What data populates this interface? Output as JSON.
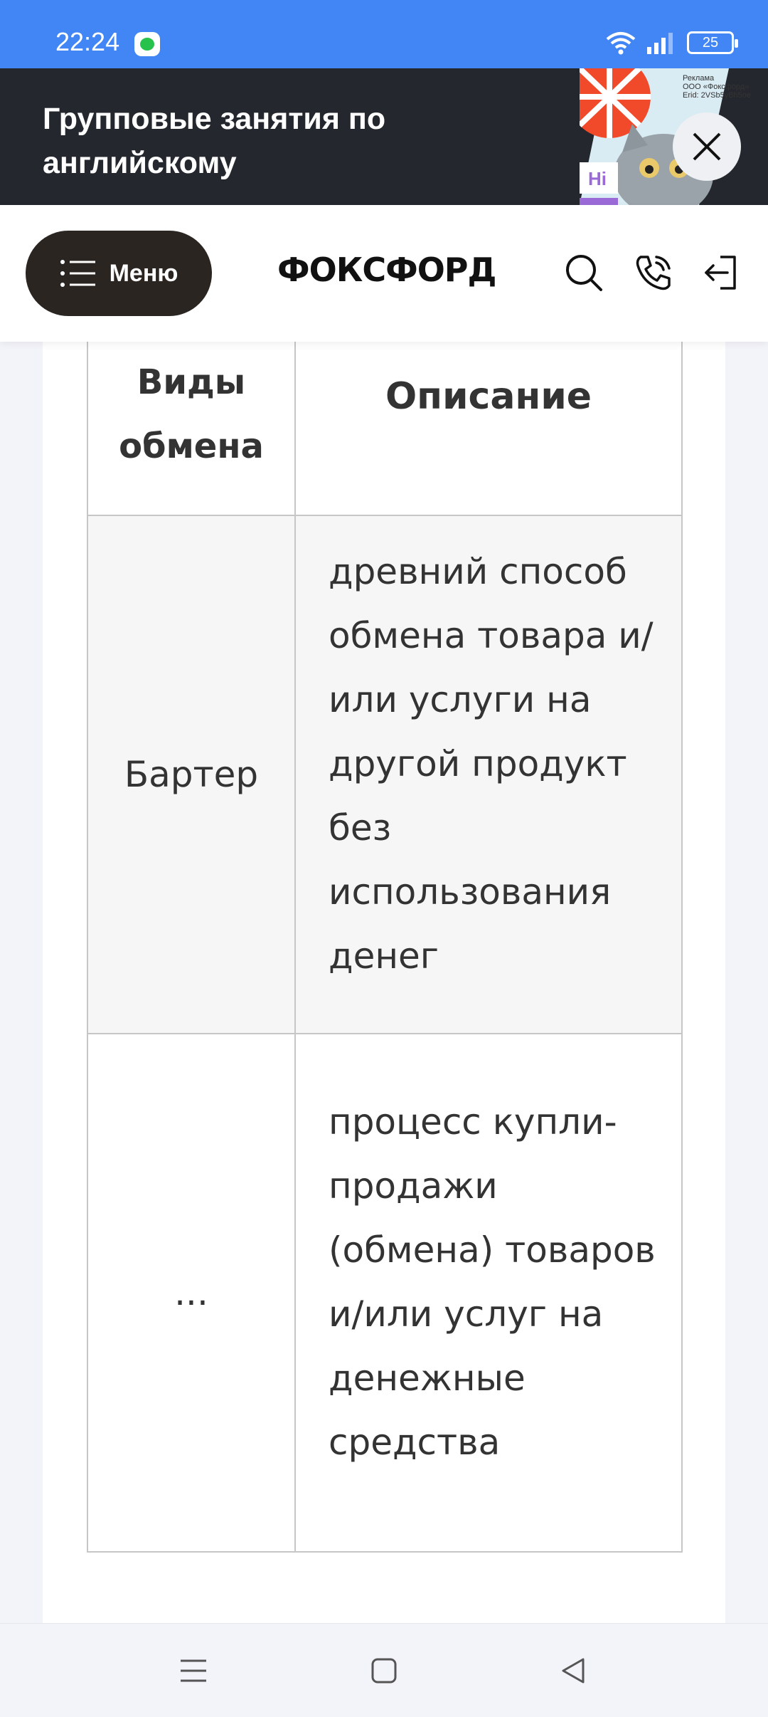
{
  "status_bar": {
    "time": "22:24",
    "battery": "25",
    "icons": [
      "message-app-icon",
      "wifi-icon",
      "signal-icon",
      "battery-icon"
    ]
  },
  "ad": {
    "title": "Групповые занятия по английскому",
    "meta_line1": "Реклама",
    "meta_line2": "ООО «Фоксфорд»",
    "meta_line3": "Erid: 2VSb5yBh5oe",
    "hi_badge": "Hi",
    "colors": {
      "background": "#24272e",
      "accent": "#f04a2a"
    }
  },
  "header": {
    "menu_label": "Меню",
    "logo": "ФОКСФОРД",
    "icons": [
      "search-icon",
      "phone-icon",
      "login-icon"
    ]
  },
  "table": {
    "headers": [
      "Виды обмена",
      "Описание"
    ],
    "rows": [
      {
        "type": "Бартер",
        "description": "древний способ обмена товара и/или услуги на другой продукт без использования денег"
      },
      {
        "type": "...",
        "description": "процесс купли-продажи (обмена) товаров и/или услуг на денежные средства"
      }
    ]
  },
  "nav_bar": {
    "icons": [
      "menu-icon",
      "home-icon",
      "back-icon"
    ]
  }
}
